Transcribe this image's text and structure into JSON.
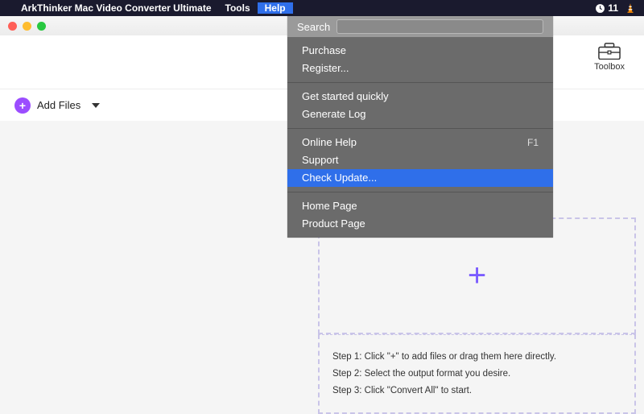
{
  "menubar": {
    "app_name": "ArkThinker Mac Video Converter Ultimate",
    "items": [
      "Tools",
      "Help"
    ],
    "right_number": "11"
  },
  "help_menu": {
    "search_label": "Search",
    "search_value": "",
    "groups": [
      [
        {
          "label": "Purchase",
          "shortcut": ""
        },
        {
          "label": "Register...",
          "shortcut": ""
        }
      ],
      [
        {
          "label": "Get started quickly",
          "shortcut": ""
        },
        {
          "label": "Generate Log",
          "shortcut": ""
        }
      ],
      [
        {
          "label": "Online Help",
          "shortcut": "F1"
        },
        {
          "label": "Support",
          "shortcut": ""
        },
        {
          "label": "Check Update...",
          "shortcut": "",
          "highlight": true
        }
      ],
      [
        {
          "label": "Home Page",
          "shortcut": ""
        },
        {
          "label": "Product Page",
          "shortcut": ""
        }
      ]
    ]
  },
  "toolbar": {
    "toolbox_label": "Toolbox",
    "add_files_label": "Add Files"
  },
  "dropzone": {
    "plus": "+",
    "steps": [
      "Step 1: Click \"+\" to add files or drag them here directly.",
      "Step 2: Select the output format you desire.",
      "Step 3: Click \"Convert All\" to start."
    ]
  }
}
